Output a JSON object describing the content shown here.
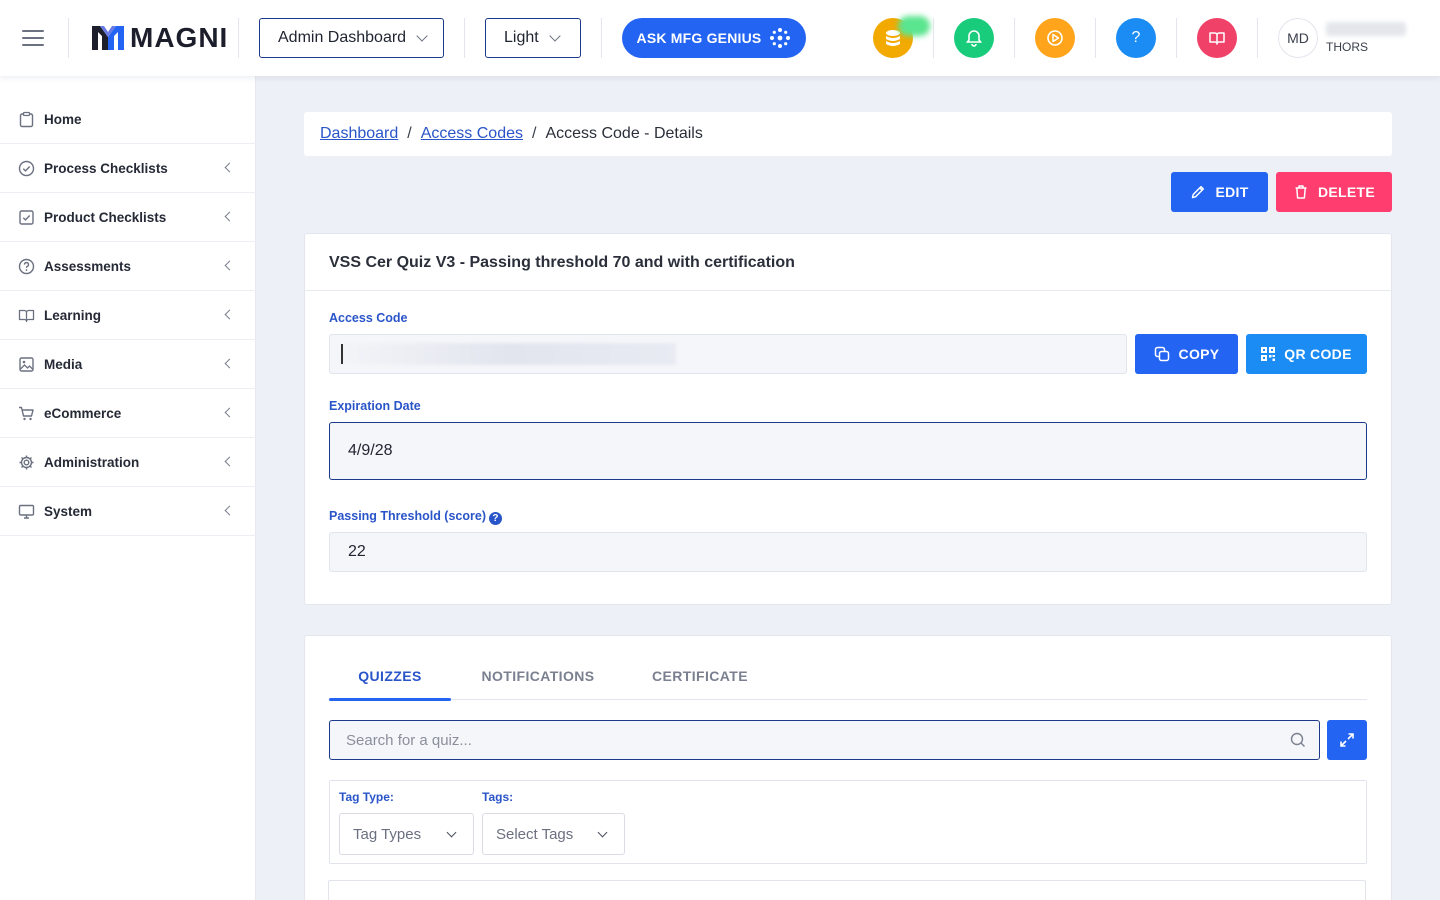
{
  "header": {
    "logo_text": "MAGNI",
    "dashboard_select": "Admin Dashboard",
    "theme_select": "Light",
    "ask_button": "ASK MFG GENIUS",
    "question_glyph": "?",
    "avatar_initials": "MD",
    "user_org": "THORS",
    "colors": {
      "coins": "#f2a900",
      "bell": "#19cc7c",
      "play": "#ffa41b",
      "help": "#1a8cf3",
      "book": "#f04168"
    }
  },
  "sidebar": {
    "items": [
      {
        "label": "Home",
        "icon": "clipboard-icon",
        "arrow": false
      },
      {
        "label": "Process Checklists",
        "icon": "check-circle-icon",
        "arrow": true
      },
      {
        "label": "Product Checklists",
        "icon": "check-square-icon",
        "arrow": true
      },
      {
        "label": "Assessments",
        "icon": "question-circle-icon",
        "arrow": true
      },
      {
        "label": "Learning",
        "icon": "book-open-icon",
        "arrow": true
      },
      {
        "label": "Media",
        "icon": "image-icon",
        "arrow": true
      },
      {
        "label": "eCommerce",
        "icon": "cart-icon",
        "arrow": true
      },
      {
        "label": "Administration",
        "icon": "gear-icon",
        "arrow": true
      },
      {
        "label": "System",
        "icon": "monitor-icon",
        "arrow": true
      }
    ]
  },
  "breadcrumb": {
    "items": [
      "Dashboard",
      "Access Codes"
    ],
    "separator": "/",
    "current": "Access Code - Details"
  },
  "actions": {
    "edit": "EDIT",
    "delete": "DELETE"
  },
  "details": {
    "title": "VSS Cer Quiz V3 - Passing threshold 70 and with certification",
    "access_code_label": "Access Code",
    "copy_button": "COPY",
    "qr_button": "QR CODE",
    "expiration_label": "Expiration Date",
    "expiration_value": "4/9/28",
    "threshold_label": "Passing Threshold (score)",
    "threshold_help": "?",
    "threshold_value": "22"
  },
  "tabs": {
    "items": [
      "QUIZZES",
      "NOTIFICATIONS",
      "CERTIFICATE"
    ],
    "active": "QUIZZES"
  },
  "quiz_search": {
    "placeholder": "Search for a quiz..."
  },
  "filters": {
    "tag_type_label": "Tag Type:",
    "tag_type_value": "Tag Types",
    "tags_label": "Tags:",
    "tags_value": "Select Tags"
  }
}
